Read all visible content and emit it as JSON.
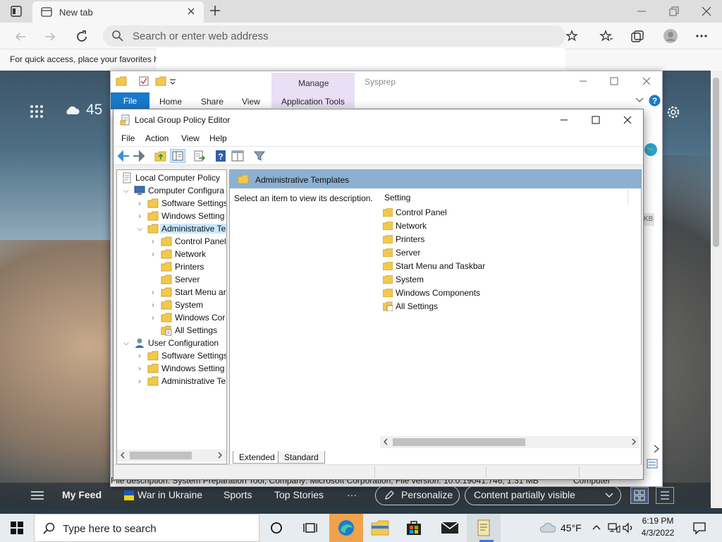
{
  "browser": {
    "tab_title": "New tab",
    "address_placeholder": "Search or enter web address",
    "favorites_hint": "For quick access, place your favorites h"
  },
  "newtab": {
    "weather_temp": "45",
    "feed": {
      "my_feed": "My Feed",
      "items": [
        "War in Ukraine",
        "Sports",
        "Top Stories"
      ],
      "more": "···",
      "personalize": "Personalize",
      "visibility": "Content partially visible"
    }
  },
  "explorer": {
    "manage_label": "Manage",
    "window_title": "Sysprep",
    "tabs": [
      "File",
      "Home",
      "Share",
      "View",
      "Application Tools"
    ],
    "status_text": "File description: System Preparation Tool, Company: Microsoft Corporation, File version: 10.0.19041.746, 1.31 MB",
    "status_right": "Computer"
  },
  "gpe": {
    "title": "Local Group Policy Editor",
    "menu": [
      "File",
      "Action",
      "View",
      "Help"
    ],
    "tree": {
      "root": "Local Computer Policy",
      "computer": "Computer Configura",
      "computer_children": [
        "Software Settings",
        "Windows Setting",
        "Administrative Te"
      ],
      "admin_children": [
        "Control Panel",
        "Network",
        "Printers",
        "Server",
        "Start Menu ar",
        "System",
        "Windows Cor",
        "All Settings"
      ],
      "user": "User Configuration",
      "user_children": [
        "Software Settings",
        "Windows Setting",
        "Administrative Te"
      ]
    },
    "pane_header": "Administrative Templates",
    "description": "Select an item to view its description.",
    "column_header": "Setting",
    "settings": [
      "Control Panel",
      "Network",
      "Printers",
      "Server",
      "Start Menu and Taskbar",
      "System",
      "Windows Components",
      "All Settings"
    ],
    "view_tabs": [
      "Extended",
      "Standard"
    ]
  },
  "taskbar": {
    "search_placeholder": "Type here to search",
    "weather": "45°F",
    "time": "6:19 PM",
    "date": "4/3/2022"
  },
  "colors": {
    "ribbon_file": "#1979ca",
    "manage_tab": "#eadff5",
    "pane_header": "#8cb0d2",
    "selection": "#cce8ff",
    "folder": "#f2c94c"
  }
}
